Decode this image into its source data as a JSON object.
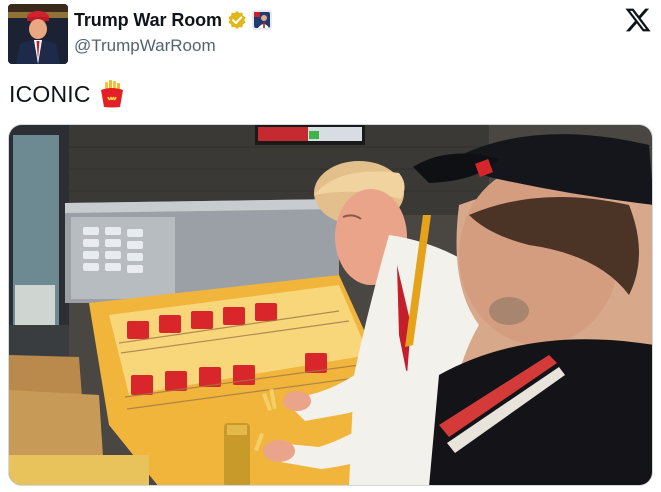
{
  "account": {
    "display_name": "Trump War Room",
    "handle": "@TrumpWarRoom",
    "verified_icon": "gold-verified-badge-icon",
    "affiliate_icon": "affiliate-badge-icon"
  },
  "brand": {
    "logo_icon": "x-logo-icon"
  },
  "tweet": {
    "text": "ICONIC",
    "emoji_icon": "french-fries-emoji-icon"
  },
  "media": {
    "type": "video-frame",
    "description_icon": "video-thumbnail"
  },
  "colors": {
    "handle": "#536471",
    "verified_gold": "#e2b719",
    "text": "#0f1419"
  }
}
